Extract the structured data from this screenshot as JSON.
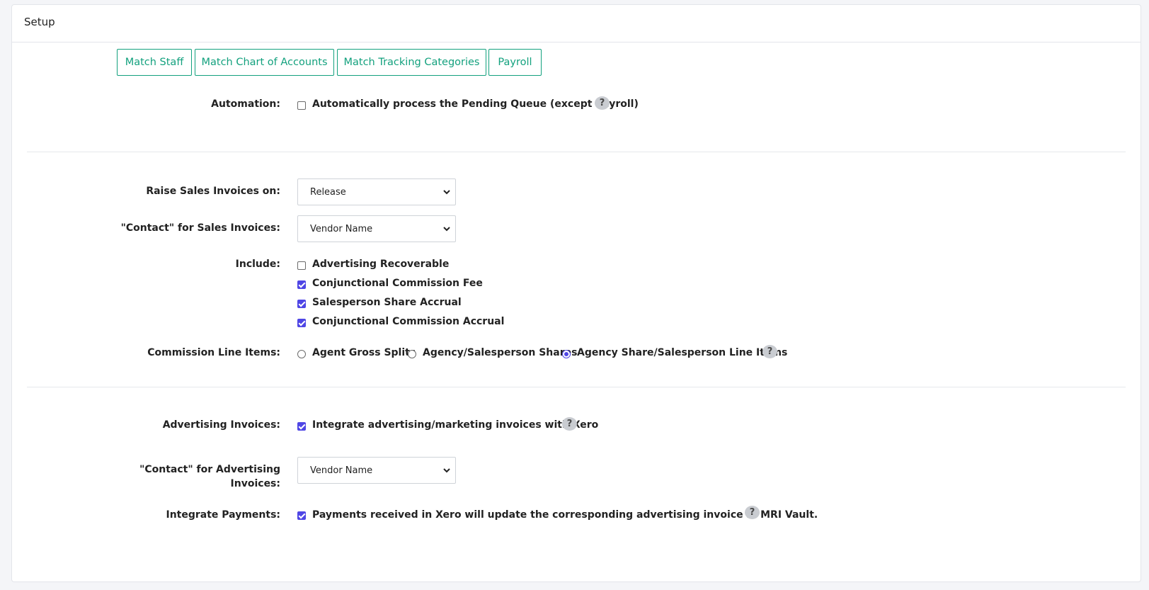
{
  "header": {
    "title": "Setup"
  },
  "tabs": [
    {
      "label": "Match Staff"
    },
    {
      "label": "Match Chart of Accounts"
    },
    {
      "label": "Match Tracking Categories"
    },
    {
      "label": "Payroll"
    }
  ],
  "automation": {
    "label": "Automation:",
    "option": {
      "label": "Automatically process the Pending Queue (except Payroll)",
      "checked": false
    }
  },
  "raise_sales": {
    "label": "Raise Sales Invoices on:",
    "value": "Release"
  },
  "contact_sales": {
    "label": "\"Contact\" for Sales Invoices:",
    "value": "Vendor Name"
  },
  "include": {
    "label": "Include:",
    "items": [
      {
        "label": "Advertising Recoverable",
        "checked": false
      },
      {
        "label": "Conjunctional Commission Fee",
        "checked": true
      },
      {
        "label": "Salesperson Share Accrual",
        "checked": true
      },
      {
        "label": "Conjunctional Commission Accrual",
        "checked": true
      }
    ]
  },
  "commission": {
    "label": "Commission Line Items:",
    "options": [
      {
        "label": "Agent Gross Splits",
        "selected": false
      },
      {
        "label": "Agency/Salesperson Shares",
        "selected": false
      },
      {
        "label": "Agency Share/Salesperson Line Items",
        "selected": true
      }
    ]
  },
  "advertising": {
    "label": "Advertising Invoices:",
    "option": {
      "label": "Integrate advertising/marketing invoices with Xero",
      "checked": true
    }
  },
  "contact_advertising": {
    "label_line1": "\"Contact\" for Advertising",
    "label_line2": "Invoices:",
    "value": "Vendor Name"
  },
  "payments": {
    "label": "Integrate Payments:",
    "option": {
      "label": "Payments received in Xero will update the corresponding advertising invoice in MRI Vault.",
      "checked": true
    }
  },
  "help_glyph": "?",
  "colors": {
    "accent_green": "#13a17e",
    "check_purple": "#4f46e5"
  }
}
